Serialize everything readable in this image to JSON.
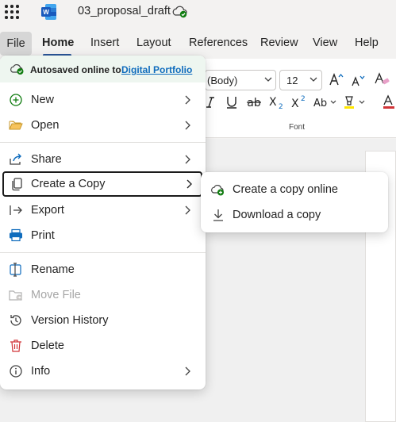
{
  "app": {
    "doc_title": "03_proposal_draft"
  },
  "menubar": {
    "tabs": [
      "File",
      "Home",
      "Insert",
      "Layout",
      "References",
      "Review",
      "View",
      "Help"
    ]
  },
  "ribbon": {
    "font_name": "(Body)",
    "font_size": "12",
    "font_group_label": "Font"
  },
  "file_menu": {
    "autosave_text": "Autosaved online to",
    "autosave_link": "Digital Portfolio",
    "items": [
      {
        "label": "New",
        "icon": "plus-circle-icon",
        "submenu": true
      },
      {
        "label": "Open",
        "icon": "folder-open-icon",
        "submenu": true
      },
      {
        "label": "Share",
        "icon": "share-icon",
        "submenu": true
      },
      {
        "label": "Create a Copy",
        "icon": "copy-icon",
        "submenu": true,
        "selected": true
      },
      {
        "label": "Export",
        "icon": "export-icon",
        "submenu": true
      },
      {
        "label": "Print",
        "icon": "printer-icon",
        "submenu": false
      },
      {
        "label": "Rename",
        "icon": "rename-icon",
        "submenu": false
      },
      {
        "label": "Move File",
        "icon": "move-file-icon",
        "submenu": false,
        "disabled": true
      },
      {
        "label": "Version History",
        "icon": "history-icon",
        "submenu": false
      },
      {
        "label": "Delete",
        "icon": "trash-icon",
        "submenu": false
      },
      {
        "label": "Info",
        "icon": "info-icon",
        "submenu": true
      }
    ]
  },
  "submenu": {
    "items": [
      {
        "label": "Create a copy online",
        "icon": "cloud-add-icon"
      },
      {
        "label": "Download a copy",
        "icon": "download-icon"
      }
    ]
  },
  "colors": {
    "accent": "#2b579a",
    "link": "#0f6cbd",
    "autosave_bg": "#eef6f0",
    "success": "#107c10",
    "delete": "#d13438"
  }
}
